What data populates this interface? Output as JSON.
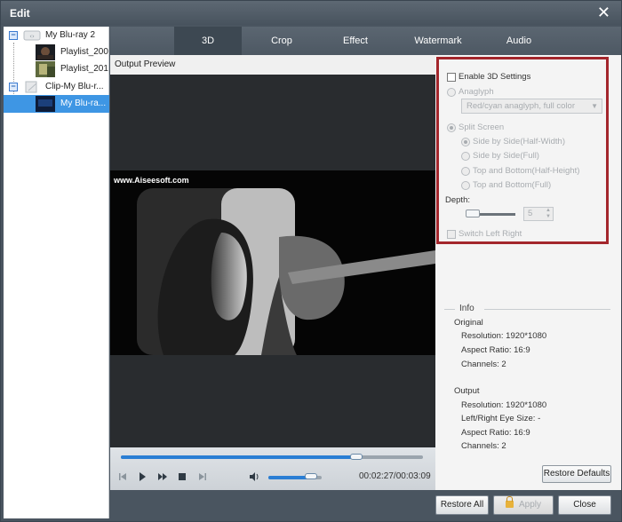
{
  "window": {
    "title": "Edit",
    "close_glyph": "✕"
  },
  "tree": {
    "items": [
      {
        "label": "My Blu-ray 2",
        "icon": "bluray-disc-icon"
      },
      {
        "label": "Playlist_200",
        "icon": "video-thumbnail-icon"
      },
      {
        "label": "Playlist_201",
        "icon": "video-thumbnail-icon"
      },
      {
        "label": "Clip-My Blu-r...",
        "icon": "clip-icon"
      },
      {
        "label": "My Blu-ra...",
        "icon": "video-thumbnail-icon"
      }
    ]
  },
  "tabs": [
    "3D",
    "Crop",
    "Effect",
    "Watermark",
    "Audio"
  ],
  "active_tab": "3D",
  "preview": {
    "label": "Output Preview",
    "watermark": "www.Aiseesoft.com"
  },
  "player": {
    "progress": 0.78,
    "volume": 0.8,
    "time": "00:02:27/00:03:09",
    "icons": [
      "prev-icon",
      "play-icon",
      "fast-forward-icon",
      "stop-icon",
      "next-icon",
      "volume-icon"
    ]
  },
  "settings3d": {
    "enable_label": "Enable 3D Settings",
    "enable_checked": false,
    "anaglyph_label": "Anaglyph",
    "anaglyph_value": "Red/cyan anaglyph, full color",
    "split_label": "Split Screen",
    "split_options": [
      "Side by Side(Half-Width)",
      "Side by Side(Full)",
      "Top and Bottom(Half-Height)",
      "Top and Bottom(Full)"
    ],
    "depth_label": "Depth:",
    "depth_value": "5",
    "switch_label": "Switch Left Right"
  },
  "info": {
    "title": "Info",
    "original_label": "Original",
    "original": [
      "Resolution: 1920*1080",
      "Aspect Ratio: 16:9",
      "Channels: 2"
    ],
    "output_label": "Output",
    "output": [
      "Resolution: 1920*1080",
      "Left/Right Eye Size: -",
      "Aspect Ratio: 16:9",
      "Channels: 2"
    ]
  },
  "buttons": {
    "restore_defaults": "Restore Defaults",
    "restore_all": "Restore All",
    "apply": "Apply",
    "close": "Close"
  },
  "colors": {
    "accent": "#2a7ed4",
    "highlight_border": "#a3262c",
    "selected_row": "#3e96e4"
  }
}
